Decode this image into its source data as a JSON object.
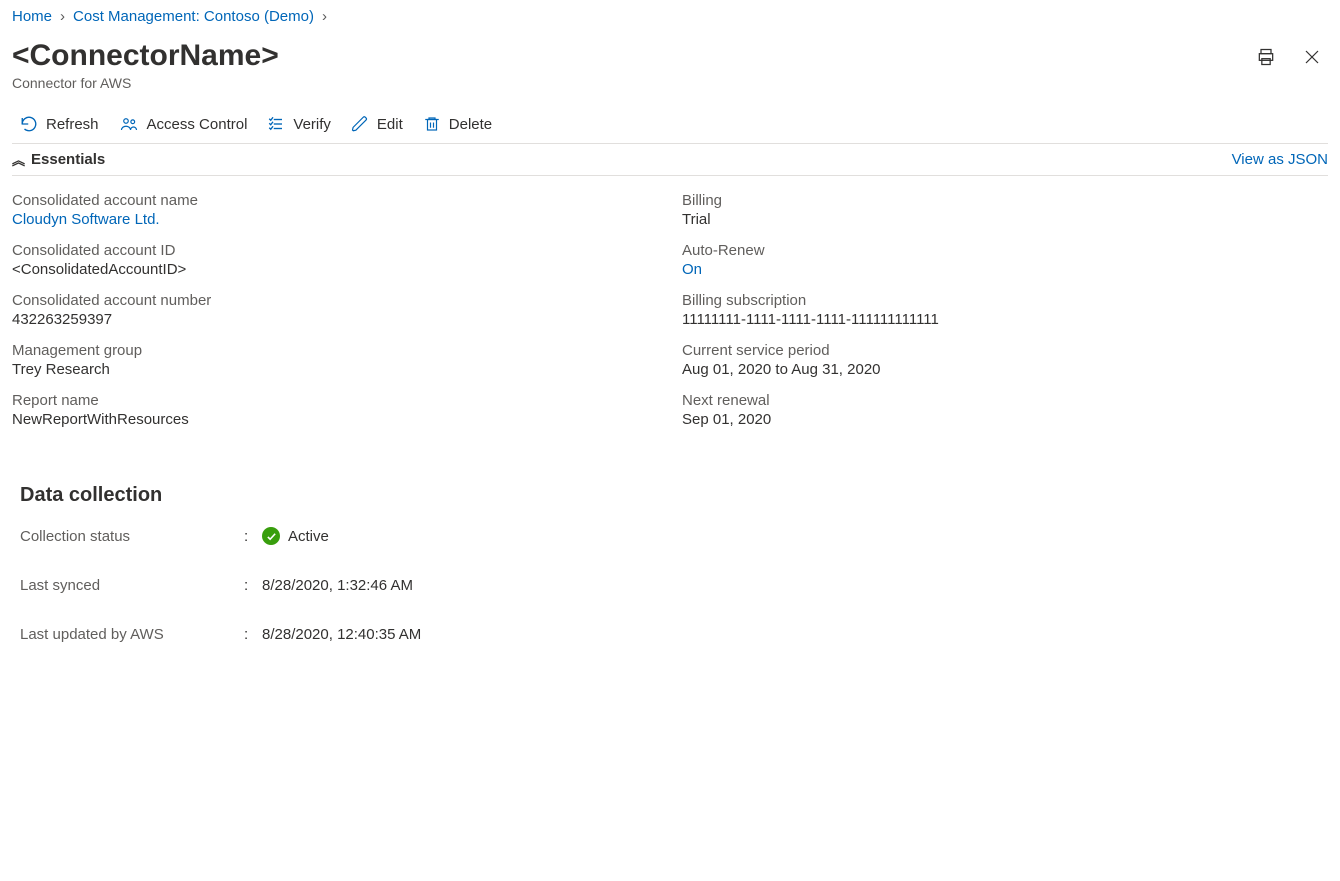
{
  "breadcrumb": {
    "home": "Home",
    "cost_mgmt": "Cost Management: Contoso (Demo)"
  },
  "header": {
    "title": "<ConnectorName>",
    "subtitle": "Connector for AWS"
  },
  "toolbar": {
    "refresh": "Refresh",
    "access_control": "Access Control",
    "verify": "Verify",
    "edit": "Edit",
    "delete": "Delete"
  },
  "essentials_bar": {
    "label": "Essentials",
    "json_link": "View as JSON"
  },
  "essentials": {
    "left": {
      "consolidated_account_name_label": "Consolidated account name",
      "consolidated_account_name_value": "Cloudyn Software Ltd.",
      "consolidated_account_id_label": "Consolidated account ID",
      "consolidated_account_id_value": "<ConsolidatedAccountID>",
      "consolidated_account_number_label": "Consolidated account number",
      "consolidated_account_number_value": "432263259397",
      "management_group_label": "Management group",
      "management_group_value": "Trey Research",
      "report_name_label": "Report name",
      "report_name_value": "NewReportWithResources"
    },
    "right": {
      "billing_label": "Billing",
      "billing_value": "Trial",
      "auto_renew_label": "Auto-Renew",
      "auto_renew_value": "On",
      "billing_subscription_label": "Billing subscription",
      "billing_subscription_value": "11111111-1111-1111-1111-111111111111",
      "service_period_label": "Current service period",
      "service_period_value": "Aug 01, 2020 to Aug 31, 2020",
      "next_renewal_label": "Next renewal",
      "next_renewal_value": "Sep 01, 2020"
    }
  },
  "data_collection": {
    "section_title": "Data collection",
    "status_label": "Collection status",
    "status_value": "Active",
    "last_synced_label": "Last synced",
    "last_synced_value": "8/28/2020, 1:32:46 AM",
    "last_updated_label": "Last updated by AWS",
    "last_updated_value": "8/28/2020, 12:40:35 AM"
  }
}
